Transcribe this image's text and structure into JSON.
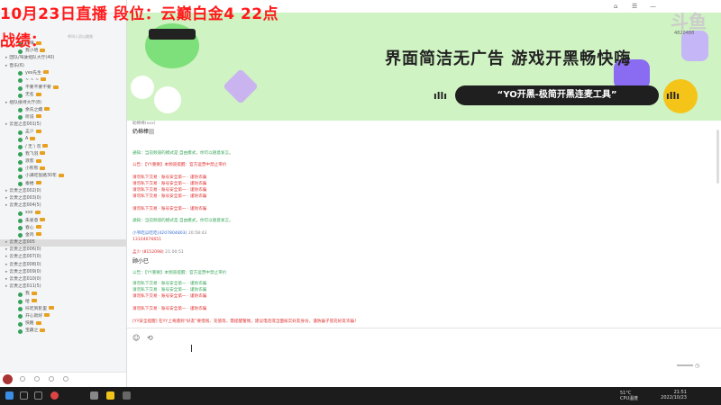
{
  "overlay": {
    "line1": "10月23日直播  段位：云巅白金4 22点",
    "line2": "战绩："
  },
  "left": {
    "search_placeholder": "呼叫人员以跳频",
    "tree": [
      {
        "type": "user",
        "name": "嗨嗨"
      },
      {
        "type": "user",
        "name": "我小哈"
      },
      {
        "type": "ch",
        "name": "团队/驾驶组队大厅(40)"
      },
      {
        "type": "ch",
        "name": "音乐(6)"
      },
      {
        "type": "user",
        "name": "yes先生"
      },
      {
        "type": "user",
        "name": "~ ~ ~"
      },
      {
        "type": "user",
        "name": "不要不要不要"
      },
      {
        "type": "user",
        "name": "无名"
      },
      {
        "type": "ch",
        "name": "组队接待大厅(8)"
      },
      {
        "type": "user",
        "name": "余氏之孀"
      },
      {
        "type": "user",
        "name": "听说"
      },
      {
        "type": "ch",
        "name": "云昆之恋001(5)"
      },
      {
        "type": "user",
        "name": "孟少"
      },
      {
        "type": "user",
        "name": "A"
      },
      {
        "type": "user",
        "name": "/ 无 \\ 勿"
      },
      {
        "type": "user",
        "name": "我飞羽"
      },
      {
        "type": "user",
        "name": "浪客"
      },
      {
        "type": "user",
        "name": "小熊熊"
      },
      {
        "type": "user",
        "name": "小满吃饭路30年"
      },
      {
        "type": "user",
        "name": "秦楼"
      },
      {
        "type": "ch",
        "name": "云贵之恋002(0)"
      },
      {
        "type": "ch",
        "name": "云贵之恋003(0)"
      },
      {
        "type": "ch",
        "name": "云贵之恋004(5)"
      },
      {
        "type": "user",
        "name": "xxx"
      },
      {
        "type": "user",
        "name": "朱爱意"
      },
      {
        "type": "user",
        "name": "春心"
      },
      {
        "type": "user",
        "name": "金鸡"
      },
      {
        "type": "ch",
        "name": "云贵之恋005",
        "selected": true
      },
      {
        "type": "ch",
        "name": "云贵之恋006(0)"
      },
      {
        "type": "ch",
        "name": "云贵之恋007(0)"
      },
      {
        "type": "ch",
        "name": "云贵之恋008(0)"
      },
      {
        "type": "ch",
        "name": "云贵之恋009(0)"
      },
      {
        "type": "ch",
        "name": "云贵之恋010(0)"
      },
      {
        "type": "ch",
        "name": "云贵之恋011(5)"
      },
      {
        "type": "user",
        "name": "我"
      },
      {
        "type": "user",
        "name": "哈"
      },
      {
        "type": "user",
        "name": "咔吃到影里"
      },
      {
        "type": "user",
        "name": "开心就好"
      },
      {
        "type": "user",
        "name": "快路"
      },
      {
        "type": "user",
        "name": "宝藏之"
      }
    ]
  },
  "banner": {
    "headline": "界面简洁无广告  游戏开黑畅快嗨",
    "pill": "“YO开黑-极简开黑连麦工具”"
  },
  "chat": {
    "msg1_author": "助棉棒(xxx)",
    "msg1_text": "奶棉棒|||",
    "notice1": "通知：当前频道的模式是 自由模式，你可以随意发言。",
    "notice2": "公告：【YY重要】本频道提醒：官方运营中禁止带价",
    "notice_body": "请勿私下交易 · 账号安全第一 · 谨防诈骗",
    "author2": "小爷吃瓜吃吃(4207804803)",
    "time2": "20:58:43",
    "text2": "13104076651",
    "author3": "孟少 (8152098)",
    "time3": "21:00:51",
    "text3": "顾小巳",
    "notice3": "[YY安全提醒] 在YY上将遇到“好友”要借钱、充值等，需提醒警惕，建议电话或当面核实好友身份，谨防骗子冒充好友诈骗！"
  },
  "taskbar": {
    "temp": "51°C",
    "cpu": "CPU温度",
    "time": "21:51",
    "date": "2022/10/23"
  },
  "watermark": {
    "logo": "斗鱼",
    "room": "4820488"
  }
}
